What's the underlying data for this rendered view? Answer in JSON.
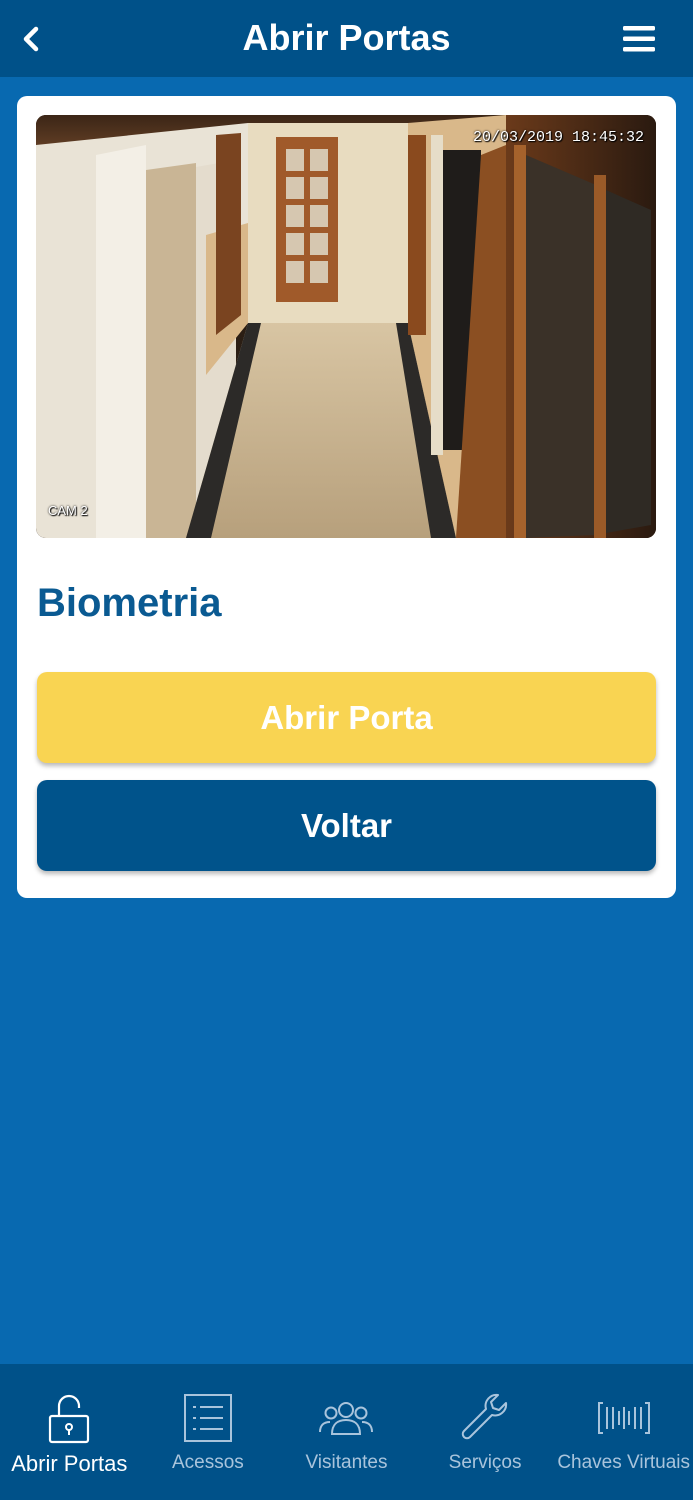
{
  "header": {
    "title": "Abrir Portas",
    "back_icon": "chevron-left-icon",
    "menu_icon": "hamburger-menu-icon"
  },
  "camera": {
    "timestamp": "20/03/2019 18:45:32",
    "label": "CAM 2"
  },
  "door": {
    "name": "Biometria"
  },
  "actions": {
    "open_label": "Abrir Porta",
    "back_label": "Voltar"
  },
  "bottom_nav": {
    "items": [
      {
        "label": "Abrir Portas",
        "icon": "open-padlock-icon",
        "active": true
      },
      {
        "label": "Acessos",
        "icon": "list-icon",
        "active": false
      },
      {
        "label": "Visitantes",
        "icon": "people-icon",
        "active": false
      },
      {
        "label": "Serviços",
        "icon": "wrench-icon",
        "active": false
      },
      {
        "label": "Chaves Virtuais",
        "icon": "barcode-icon",
        "active": false
      }
    ]
  },
  "colors": {
    "header_bg": "#005189",
    "page_bg": "#0869b0",
    "title_blue": "#0a5a92",
    "open_button": "#f9d452",
    "back_button": "#00538b",
    "nav_inactive": "#a9c4dc"
  }
}
